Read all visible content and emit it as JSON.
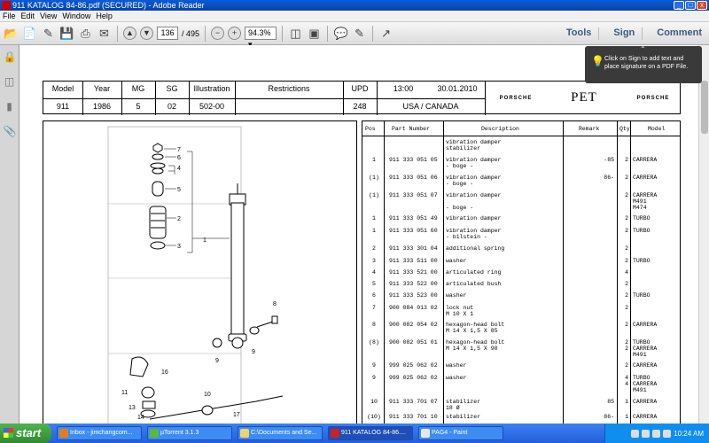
{
  "window": {
    "title": "911 KATALOG 84-86.pdf (SECURED) - Adobe Reader",
    "min": "_",
    "max": "□",
    "close": "x"
  },
  "menu": [
    "File",
    "Edit",
    "View",
    "Window",
    "Help"
  ],
  "toolbar": {
    "page_current": "136",
    "page_total": "/ 495",
    "zoom": "94.3%",
    "tools": "Tools",
    "sign": "Sign",
    "comment": "Comment"
  },
  "popup": {
    "text": "Click on Sign to add text and place signature on a PDF File."
  },
  "header": {
    "model_label": "Model",
    "model": "911",
    "year_label": "Year",
    "year": "1986",
    "mg_label": "MG",
    "mg": "5",
    "sg_label": "SG",
    "sg": "02",
    "illustration_label": "Illustration",
    "illustration": "502-00",
    "restrictions_label": "Restrictions",
    "upd_label": "UPD",
    "upd": "248",
    "time": "13:00",
    "date": "30.01.2010",
    "region": "USA / CANADA",
    "brand_left": "PORSCHE",
    "brand_center": "PET",
    "brand_right": "PORSCHE"
  },
  "illustration_callouts": [
    "7",
    "6",
    "4",
    "5",
    "2",
    "3",
    "1",
    "8",
    "9",
    "9",
    "16",
    "11",
    "13",
    "14",
    "10",
    "17"
  ],
  "parts_table": {
    "columns": [
      "Pos",
      "Part Number",
      "Description",
      "Remark",
      "Qty",
      "Model"
    ],
    "rows": [
      {
        "pos": "",
        "part": "",
        "desc": "vibration damper\nstabilizer",
        "remark": "",
        "qty": "",
        "model": ""
      },
      {
        "pos": "1",
        "part": "911 333 051 05",
        "desc": "vibration damper\n- boge -",
        "remark": "-85",
        "qty": "2",
        "model": "CARRERA"
      },
      {
        "pos": "(1)",
        "part": "911 333 051 06",
        "desc": "vibration damper\n- boge -",
        "remark": "86-",
        "qty": "2",
        "model": "CARRERA"
      },
      {
        "pos": "(1)",
        "part": "911 333 051 07",
        "desc": "vibration damper\n\n- boge -",
        "remark": "",
        "qty": "2",
        "model": "CARRERA\nM491\nM474"
      },
      {
        "pos": "1",
        "part": "911 333 051 49",
        "desc": "vibration damper",
        "remark": "",
        "qty": "2",
        "model": "TURBO"
      },
      {
        "pos": "1",
        "part": "911 333 051 60",
        "desc": "vibration damper\n- bilstein -",
        "remark": "",
        "qty": "2",
        "model": "TURBO"
      },
      {
        "pos": "2",
        "part": "911 333 301 04",
        "desc": "additional spring",
        "remark": "",
        "qty": "2",
        "model": ""
      },
      {
        "pos": "3",
        "part": "911 333 511 00",
        "desc": "washer",
        "remark": "",
        "qty": "2",
        "model": "TURBO"
      },
      {
        "pos": "4",
        "part": "911 333 521 00",
        "desc": "articulated ring",
        "remark": "",
        "qty": "4",
        "model": ""
      },
      {
        "pos": "5",
        "part": "911 333 522 00",
        "desc": "articulated bush",
        "remark": "",
        "qty": "2",
        "model": ""
      },
      {
        "pos": "6",
        "part": "911 333 523 00",
        "desc": "washer",
        "remark": "",
        "qty": "2",
        "model": "TURBO"
      },
      {
        "pos": "7",
        "part": "900 084 013 02",
        "desc": "lock nut\nM 10 X 1",
        "remark": "",
        "qty": "2",
        "model": ""
      },
      {
        "pos": "8",
        "part": "900 082 054 02",
        "desc": "hexagon-head bolt\nM 14 X 1,5 X 85",
        "remark": "",
        "qty": "2",
        "model": "CARRERA"
      },
      {
        "pos": "(8)",
        "part": "900 082 051 01",
        "desc": "hexagon-head bolt\nM 14 X 1,5 X 90",
        "remark": "",
        "qty": "2\n2",
        "model": "TURBO\nCARRERA\nM491"
      },
      {
        "pos": "9",
        "part": "999 025 062 02",
        "desc": "washer",
        "remark": "",
        "qty": "2",
        "model": "CARRERA"
      },
      {
        "pos": "9",
        "part": "999 025 062 02",
        "desc": "washer",
        "remark": "",
        "qty": "4\n4",
        "model": "TURBO\nCARRERA\nM491"
      },
      {
        "pos": "10",
        "part": "911 333 701 07",
        "desc": "stabilizer\n18 Ø",
        "remark": "85",
        "qty": "1",
        "model": "CARRERA"
      },
      {
        "pos": "(10)",
        "part": "911 333 701 10",
        "desc": "stabilizer\n...",
        "remark": "86-",
        "qty": "1",
        "model": "CARRERA"
      }
    ]
  },
  "taskbar": {
    "start": "start",
    "tasks": [
      "Inbox - jimchangcom...",
      "µTorrent 3.1.3",
      "C:\\Documents and Se...",
      "911 KATALOG 84-86....",
      "PAG4 - Paint"
    ],
    "clock": "10:24 AM"
  }
}
